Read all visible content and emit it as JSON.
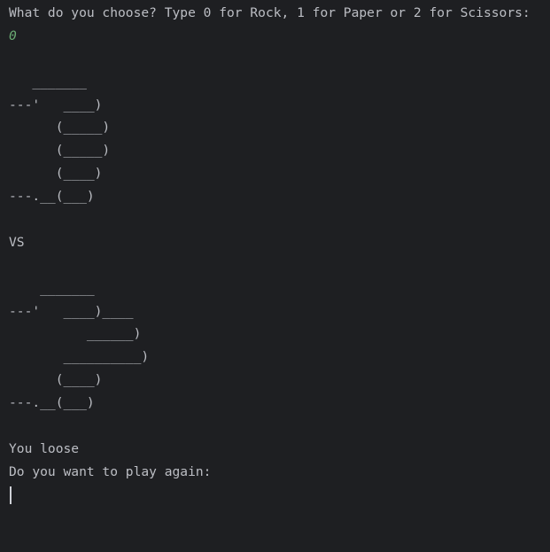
{
  "console": {
    "prompt": "What do you choose? Type 0 for Rock, 1 for Paper or 2 for Scissors:",
    "user_input": "0",
    "player_art": [
      "   _______",
      "---'   ____)",
      "      (_____)",
      "      (_____)",
      "      (____)",
      "---.__(___)"
    ],
    "vs_label": "VS",
    "computer_art": [
      "    _______",
      "---'   ____)____",
      "          ______)",
      "       __________)",
      "      (____)",
      "---.__(___)"
    ],
    "result": "You loose",
    "replay_prompt": "Do you want to play again:"
  },
  "colors": {
    "background": "#1e1f22",
    "text": "#bcbec4",
    "input": "#6aab73",
    "cursor": "#ced0d6"
  }
}
